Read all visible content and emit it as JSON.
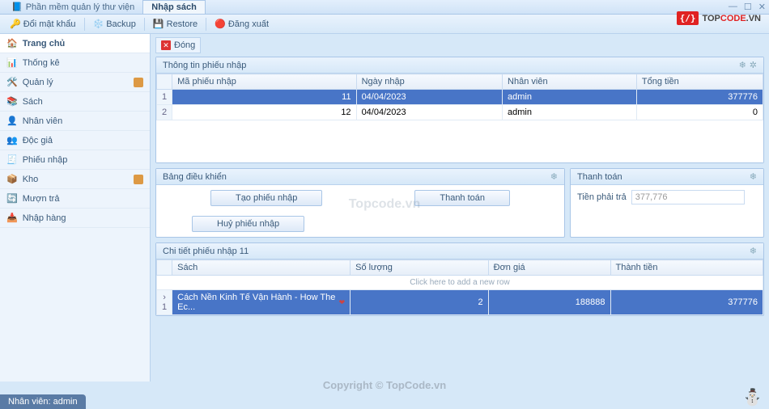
{
  "window": {
    "title": "Phần mềm quản lý thư viện",
    "active_tab": "Nhập sách"
  },
  "toolbar": {
    "change_password": "Đổi mật khẩu",
    "backup": "Backup",
    "restore": "Restore",
    "logout": "Đăng xuất"
  },
  "logo": {
    "glyph": "{/}",
    "top": "TOP",
    "code": "CODE",
    "suffix": ".VN"
  },
  "sidebar": {
    "items": [
      {
        "label": "Trang chủ",
        "icon": "home-icon",
        "active": true
      },
      {
        "label": "Thống kê",
        "icon": "stats-icon"
      },
      {
        "label": "Quản lý",
        "icon": "manage-icon",
        "badge": true
      },
      {
        "label": "Sách",
        "icon": "book-icon"
      },
      {
        "label": "Nhân viên",
        "icon": "staff-icon"
      },
      {
        "label": "Độc giả",
        "icon": "reader-icon"
      },
      {
        "label": "Phiếu nhập",
        "icon": "receipt-icon"
      },
      {
        "label": "Kho",
        "icon": "warehouse-icon",
        "badge": true
      },
      {
        "label": "Mượn trả",
        "icon": "borrow-icon"
      },
      {
        "label": "Nhập hàng",
        "icon": "import-icon"
      }
    ]
  },
  "ribbon": {
    "close": "Đóng"
  },
  "receipt_panel": {
    "title": "Thông tin phiếu nhập",
    "columns": {
      "id": "Mã phiếu nhập",
      "date": "Ngày nhập",
      "staff": "Nhân viên",
      "total": "Tổng tiền"
    },
    "rows": [
      {
        "indicator": "1",
        "id": "11",
        "date": "04/04/2023",
        "staff": "admin",
        "total": "377776",
        "selected": true
      },
      {
        "indicator": "2",
        "id": "12",
        "date": "04/04/2023",
        "staff": "admin",
        "total": "0",
        "selected": false
      }
    ]
  },
  "control_panel": {
    "title": "Bảng điều khiển",
    "create": "Tạo phiếu nhập",
    "pay": "Thanh toán",
    "cancel": "Huỷ phiếu nhập"
  },
  "payment_panel": {
    "title": "Thanh toán",
    "label": "Tiền phải trả",
    "value": "377,776"
  },
  "detail_panel": {
    "title": "Chi tiết phiếu nhập 11",
    "columns": {
      "book": "Sách",
      "qty": "Số lượng",
      "price": "Đơn giá",
      "amount": "Thành tiền"
    },
    "hint": "Click here to add a new row",
    "rows": [
      {
        "indicator": "1",
        "book": "Cách Nền Kinh Tế Vận Hành - How The Ec...",
        "qty": "2",
        "price": "188888",
        "amount": "377776",
        "selected": true
      }
    ]
  },
  "status": {
    "user_label": "Nhân viên: admin"
  },
  "watermark": "Topcode.vn",
  "copyright": "Copyright © TopCode.vn"
}
